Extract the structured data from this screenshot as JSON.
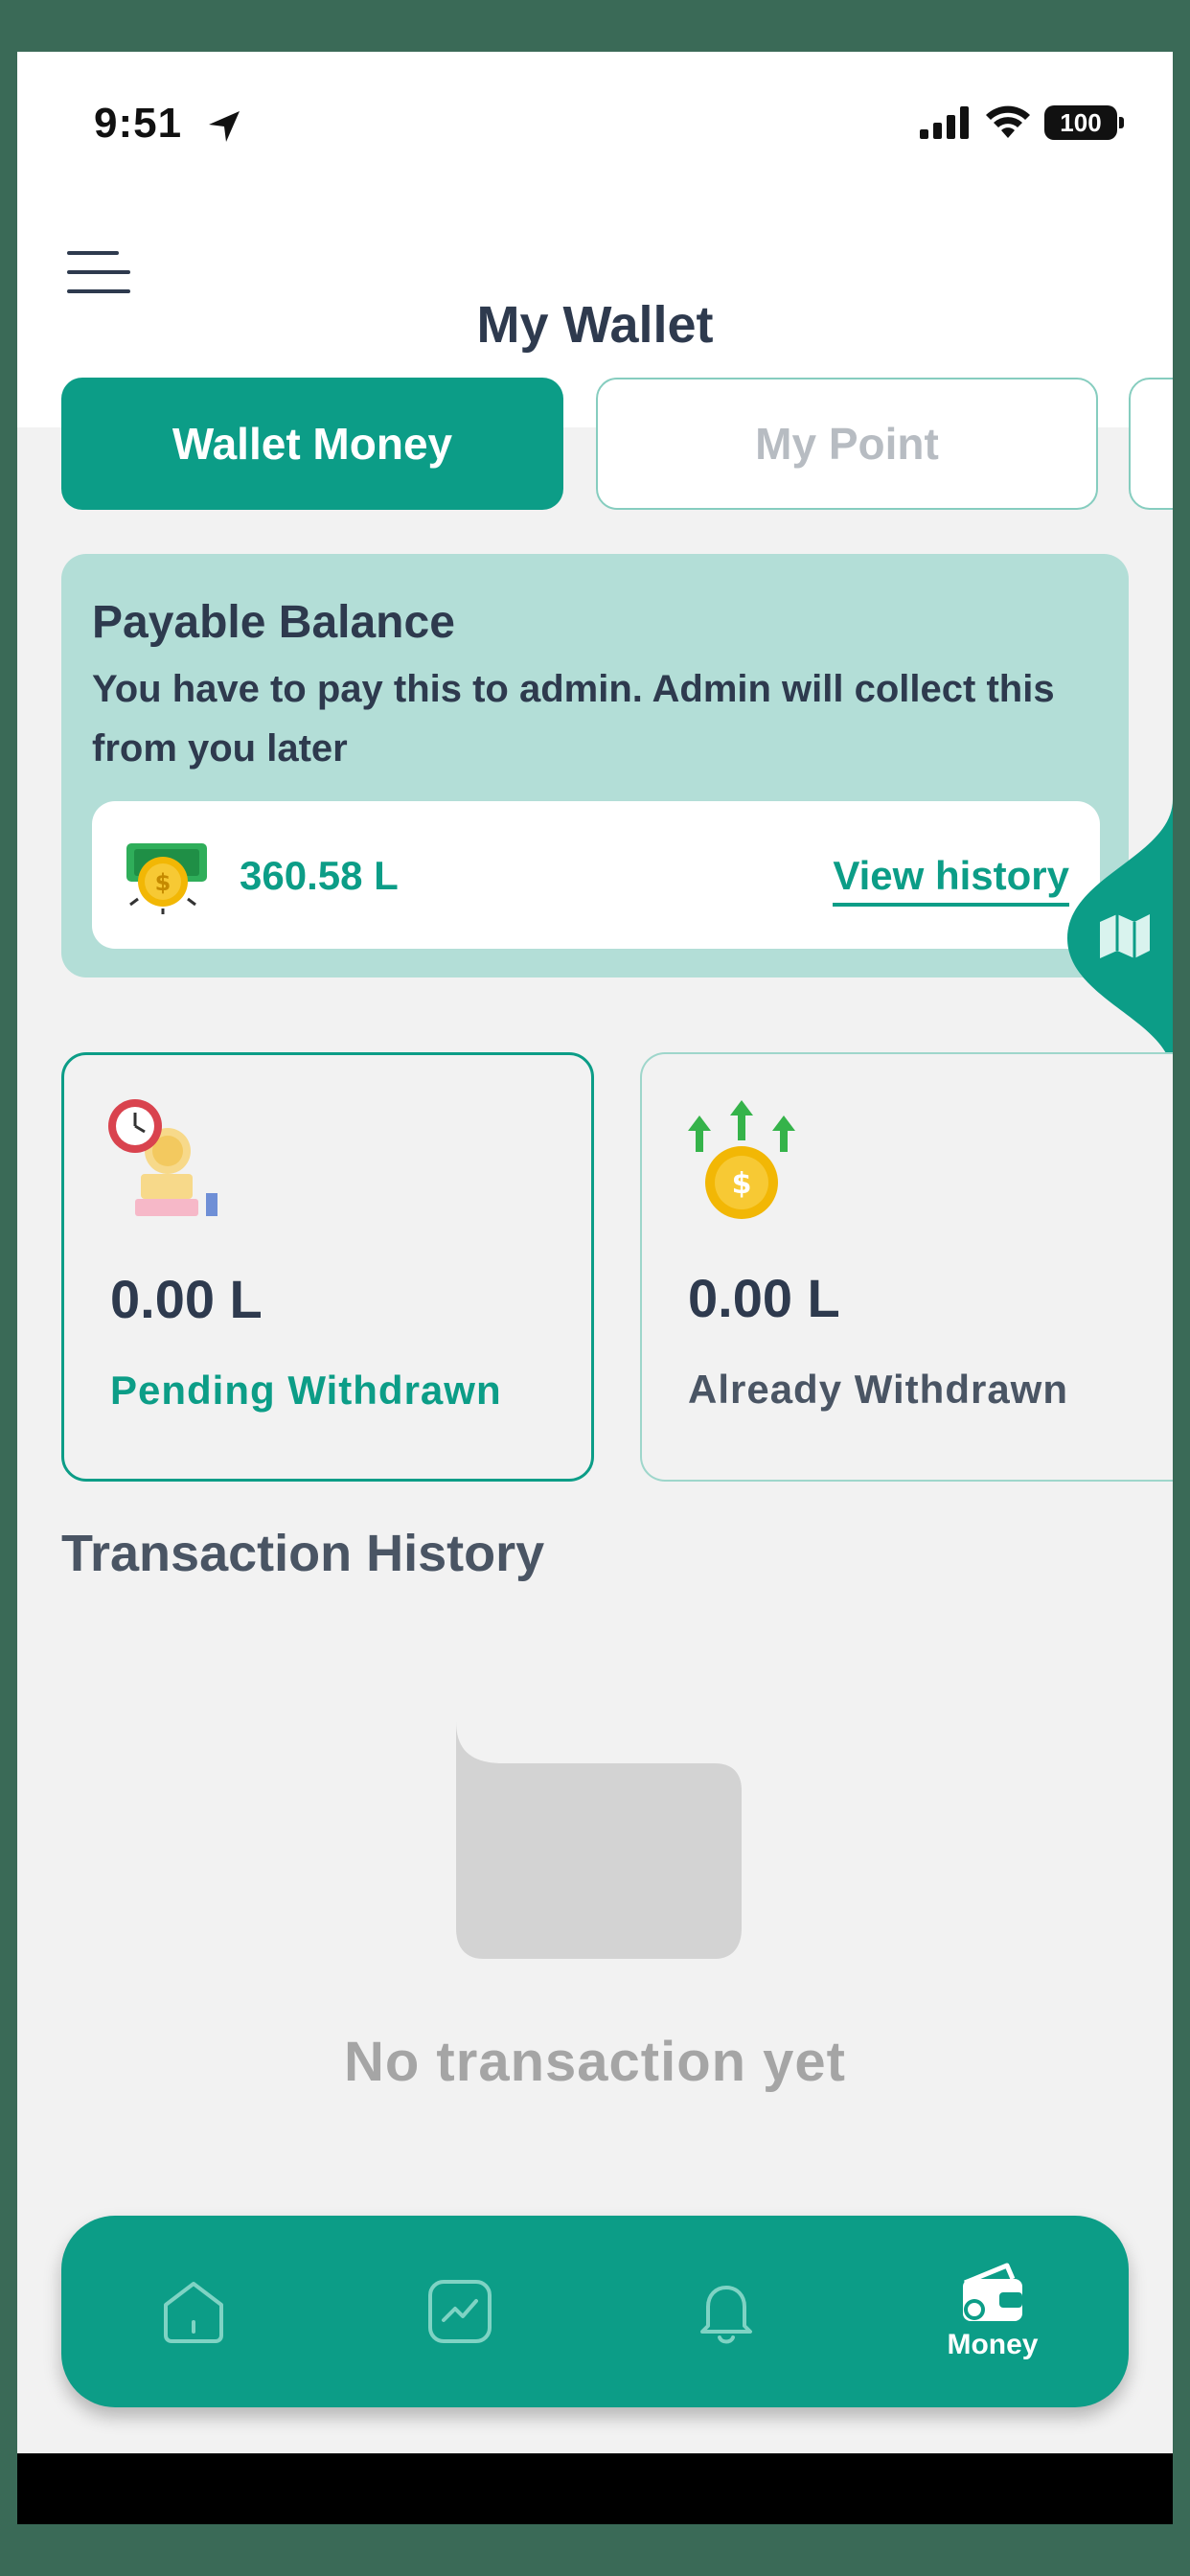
{
  "status_bar": {
    "time": "9:51",
    "battery": "100"
  },
  "header": {
    "title": "My Wallet"
  },
  "tabs": [
    {
      "label": "Wallet Money",
      "active": true
    },
    {
      "label": "My Point",
      "active": false
    }
  ],
  "payable": {
    "title": "Payable Balance",
    "description": "You have to pay this to admin. Admin will collect this from you later",
    "amount": "360.58 L",
    "view_history": "View history"
  },
  "withdraw_cards": [
    {
      "amount": "0.00 L",
      "label": "Pending Withdrawn"
    },
    {
      "amount": "0.00 L",
      "label": "Already Withdrawn"
    }
  ],
  "transactions": {
    "title": "Transaction History",
    "empty_text": "No transaction yet"
  },
  "bottom_nav": {
    "items": [
      {
        "icon": "home-icon",
        "label": ""
      },
      {
        "icon": "chart-icon",
        "label": ""
      },
      {
        "icon": "bell-icon",
        "label": ""
      },
      {
        "icon": "wallet-icon",
        "label": "Money"
      }
    ]
  },
  "colors": {
    "accent": "#0c9d87",
    "card_bg": "#b3ded7",
    "text_dark": "#2e3a4e"
  }
}
